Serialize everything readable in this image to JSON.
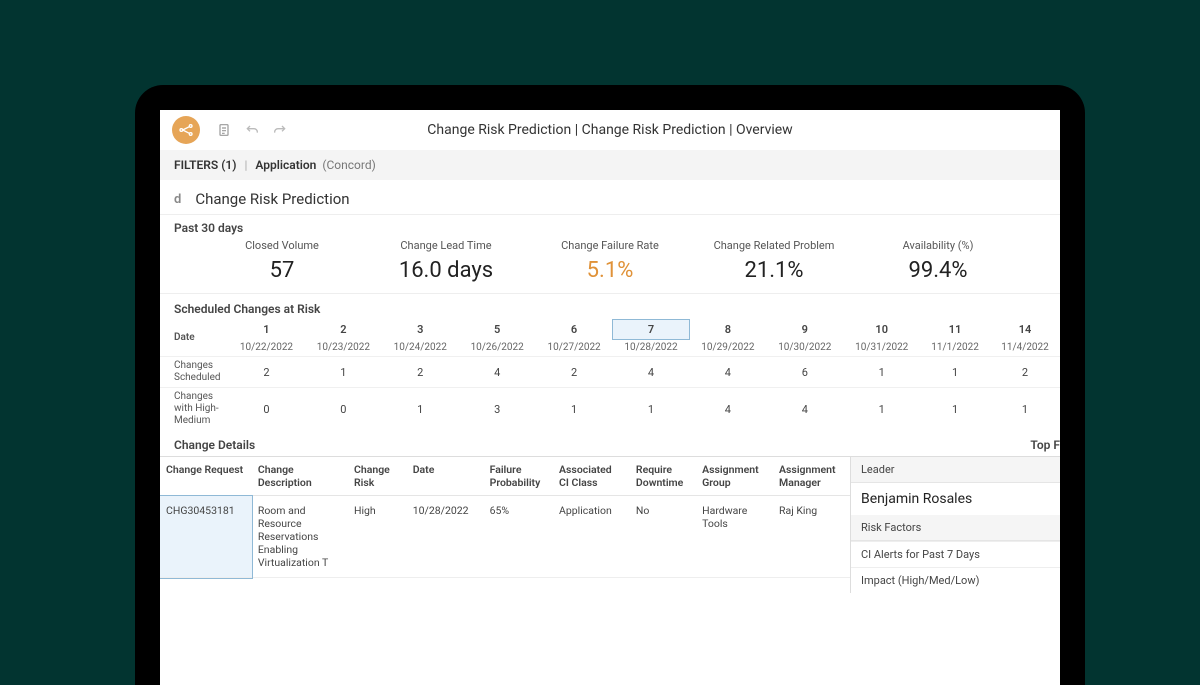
{
  "breadcrumb": {
    "a": "Change Risk Prediction",
    "b": "Change Risk Prediction",
    "c": "Overview"
  },
  "filters": {
    "label": "FILTERS (1)",
    "key": "Application",
    "value": "(Concord)"
  },
  "page_title": "Change Risk Prediction",
  "period_label": "Past 30 days",
  "kpis": {
    "closed_volume": {
      "label": "Closed Volume",
      "value": "57"
    },
    "lead_time": {
      "label": "Change Lead Time",
      "value": "16.0 days"
    },
    "failure_rate": {
      "label": "Change Failure Rate",
      "value": "5.1%"
    },
    "related_problem": {
      "label": "Change Related Problem",
      "value": "21.1%"
    },
    "availability": {
      "label": "Availability (%)",
      "value": "99.4%"
    }
  },
  "schedule": {
    "title": "Scheduled Changes at Risk",
    "date_label": "Date",
    "columns": [
      {
        "count": "1",
        "date": "10/22/2022"
      },
      {
        "count": "2",
        "date": "10/23/2022"
      },
      {
        "count": "3",
        "date": "10/24/2022"
      },
      {
        "count": "5",
        "date": "10/26/2022"
      },
      {
        "count": "6",
        "date": "10/27/2022"
      },
      {
        "count": "7",
        "date": "10/28/2022",
        "highlight": true
      },
      {
        "count": "8",
        "date": "10/29/2022"
      },
      {
        "count": "9",
        "date": "10/30/2022"
      },
      {
        "count": "10",
        "date": "10/31/2022"
      },
      {
        "count": "11",
        "date": "11/1/2022"
      },
      {
        "count": "14",
        "date": "11/4/2022"
      }
    ],
    "rows": {
      "scheduled": {
        "label": "Changes Scheduled",
        "values": [
          "2",
          "1",
          "2",
          "4",
          "2",
          "4",
          "4",
          "6",
          "1",
          "1",
          "2"
        ]
      },
      "risk": {
        "label": "Changes with High-Medium",
        "values": [
          "0",
          "0",
          "1",
          "3",
          "1",
          "1",
          "4",
          "4",
          "1",
          "1",
          "1"
        ]
      }
    }
  },
  "details": {
    "title": "Change Details",
    "top_title": "Top F",
    "columns": {
      "request": "Change Request",
      "description": "Change Description",
      "risk": "Change Risk",
      "date": "Date",
      "probability": "Failure Probability",
      "ci_class": "Associated CI Class",
      "downtime": "Require Downtime",
      "group": "Assignment Group",
      "manager": "Assignment Manager"
    },
    "row": {
      "request": "CHG30453181",
      "description": "Room and Resource Reservations Enabling Virtualization T",
      "risk": "High",
      "date": "10/28/2022",
      "probability": "65%",
      "ci_class": "Application",
      "downtime": "No",
      "group": "Hardware Tools",
      "manager": "Raj King"
    }
  },
  "side": {
    "leader_label": "Leader",
    "leader_value": "Benjamin Rosales",
    "risk_factors_label": "Risk Factors",
    "rf1": "CI Alerts for Past 7 Days",
    "rf2": "Impact (High/Med/Low)"
  }
}
